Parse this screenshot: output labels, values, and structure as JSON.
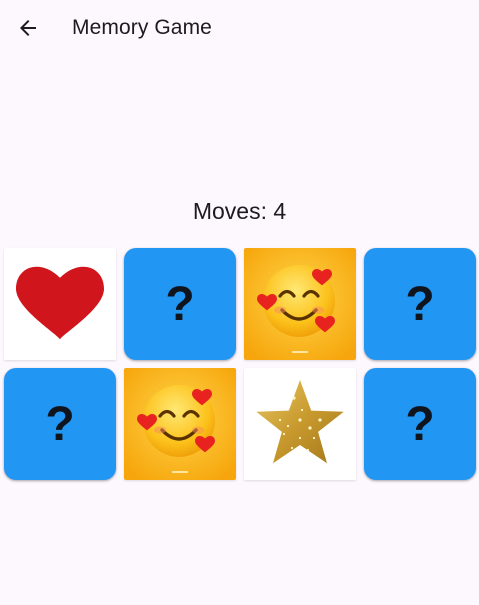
{
  "app_bar": {
    "title": "Memory Game",
    "back_icon": "arrow-left-icon"
  },
  "game": {
    "moves_label": "Moves",
    "moves_value": "4",
    "hidden_symbol": "?",
    "colors": {
      "card_back": "#2196f3",
      "background": "#fdf7fe"
    },
    "cards": [
      {
        "state": "revealed",
        "image": "heart"
      },
      {
        "state": "hidden",
        "image": ""
      },
      {
        "state": "revealed",
        "image": "smiling-face-with-hearts"
      },
      {
        "state": "hidden",
        "image": ""
      },
      {
        "state": "hidden",
        "image": ""
      },
      {
        "state": "revealed",
        "image": "smiling-face-with-hearts"
      },
      {
        "state": "revealed",
        "image": "gold-star"
      },
      {
        "state": "hidden",
        "image": ""
      }
    ]
  }
}
